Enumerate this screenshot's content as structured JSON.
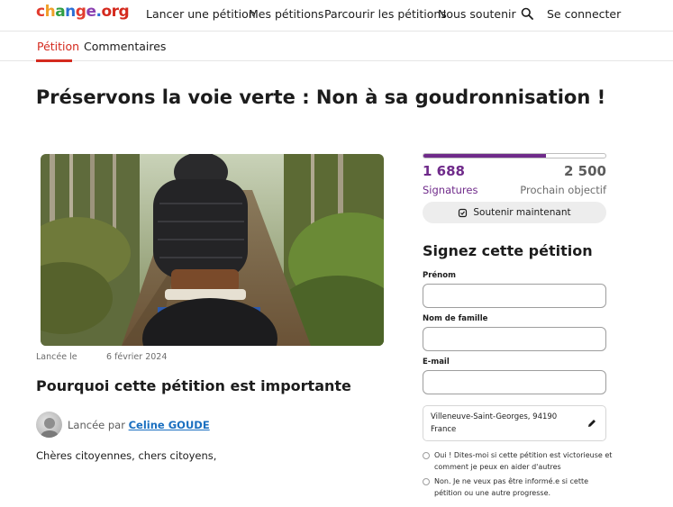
{
  "logo": {
    "text": "change.org"
  },
  "nav": {
    "start_petition": "Lancer une pétition",
    "my_petitions": "Mes pétitions",
    "browse": "Parcourir les pétitions",
    "support_us": "Nous soutenir",
    "login": "Se connecter",
    "search_icon": "search-icon"
  },
  "tabs": {
    "petition": "Pétition",
    "comments": "Commentaires"
  },
  "petition": {
    "title": "Préservons la voie verte : Non à sa goudronnisation !",
    "launched_label": "Lancée le",
    "launched_date": "6 février 2024",
    "why_title": "Pourquoi cette pétition est importante",
    "launched_by_prefix": "Lancée par",
    "author": "Celine GOUDE",
    "body_start": "Chères citoyennes, chers citoyens,"
  },
  "signatures": {
    "count": "1 688",
    "goal": "2 500",
    "count_label": "Signatures",
    "goal_label": "Prochain objectif",
    "progress_fraction": 0.675,
    "support_button": "Soutenir maintenant"
  },
  "sign_form": {
    "title": "Signez cette pétition",
    "first_name_label": "Prénom",
    "last_name_label": "Nom de famille",
    "email_label": "E-mail",
    "location_city": "Villeneuve-Saint-Georges, 94190",
    "location_country": "France",
    "option_yes": "Oui ! Dites-moi si cette pétition est victorieuse et comment je peux en aider d'autres",
    "option_no": "Non. Je ne veux pas être informé.e si cette pétition ou une autre progresse."
  },
  "colors": {
    "brand_red": "#d42a1e",
    "purple": "#6f2a8a",
    "link_blue": "#1a6fc0"
  }
}
